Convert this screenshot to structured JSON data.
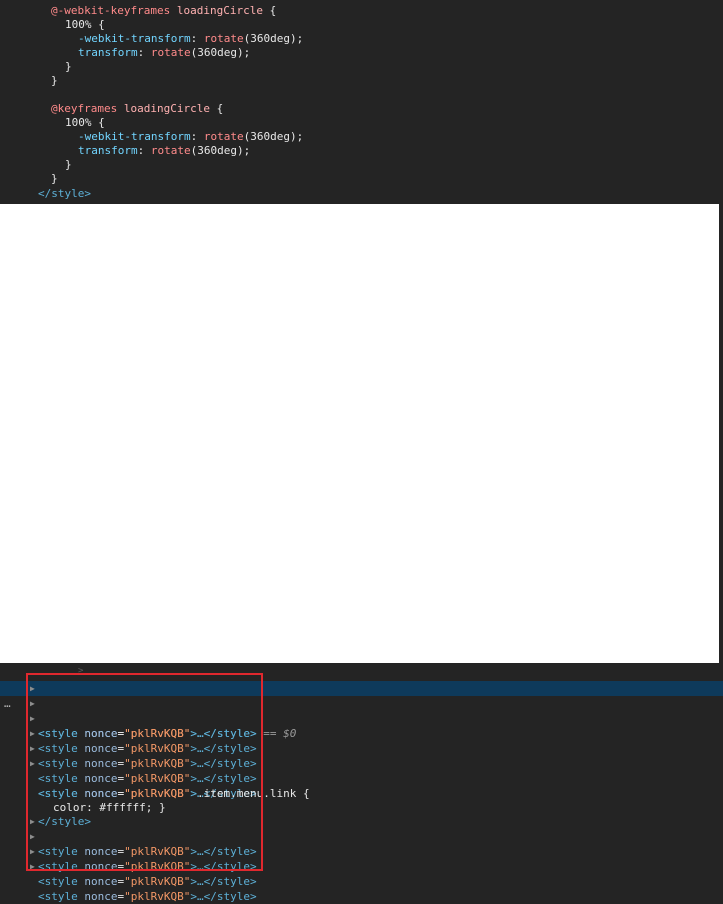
{
  "code_top": {
    "kf1_at": "@-webkit-keyframes",
    "kf1_name": "loadingCircle",
    "brace_open": "{",
    "brace_close": "}",
    "pct": "100%",
    "prop_webkit": "-webkit-transform",
    "prop_transform": "transform",
    "fn_rotate": "rotate",
    "arg": "(360deg);",
    "colon": ":",
    "kf2_at": "@keyframes",
    "kf2_name": "loadingCircle",
    "style_close": "</style>"
  },
  "elements": {
    "tag_open": "<style",
    "attr_name": "nonce",
    "attr_eq": "=",
    "attr_value": "\"pklRvKQB\"",
    "collapsed_inner": ">…",
    "tag_close": "</style>",
    "selected_marker": "== $0",
    "more_dots": "…",
    "inline_selector": ".item.menu.link {",
    "inline_rule": "color: #ffffff; }",
    "inline_close": "</style>",
    "tag_gt": ">"
  }
}
